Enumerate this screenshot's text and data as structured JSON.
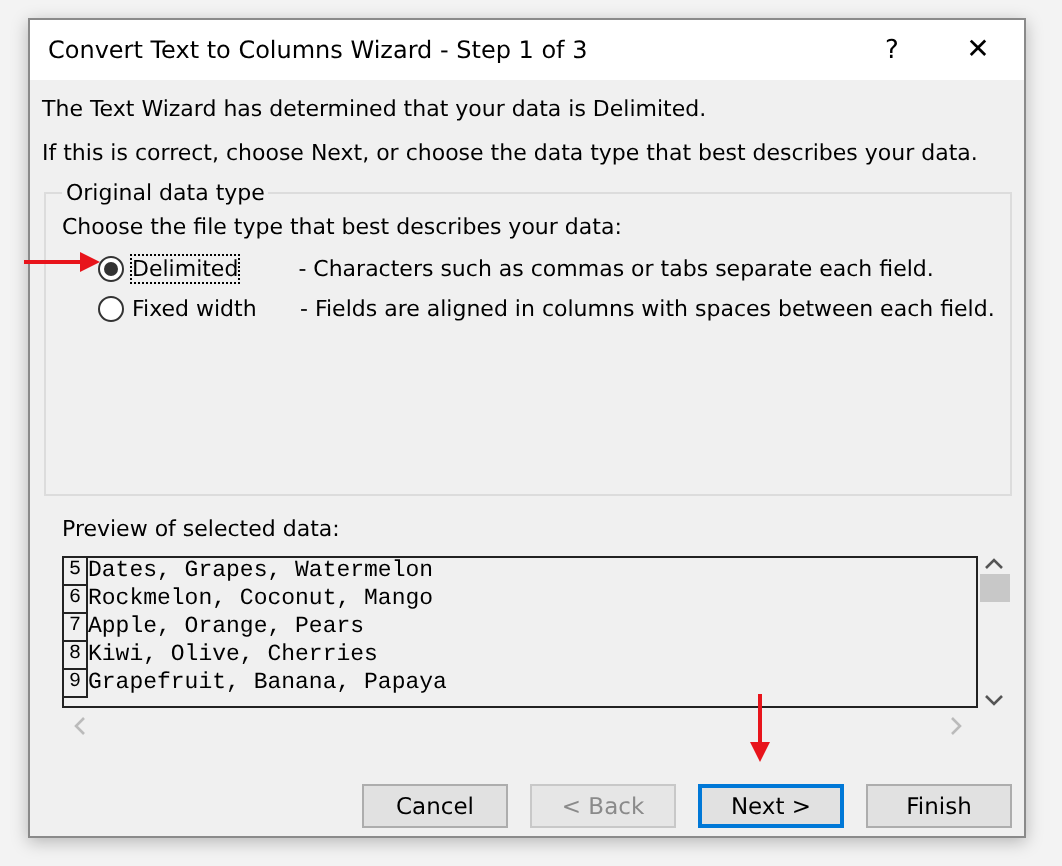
{
  "window": {
    "title": "Convert Text to Columns Wizard - Step 1 of 3",
    "help": "?",
    "close": "✕"
  },
  "intro": [
    "The Text Wizard has determined that your data is Delimited.",
    "If this is correct, choose Next, or choose the data type that best describes your data."
  ],
  "group": {
    "title": "Original data type",
    "prompt": "Choose the file type that best describes your data:",
    "options": [
      {
        "label": "Delimited",
        "description": "- Characters such as commas or tabs separate each field.",
        "selected": true
      },
      {
        "label": "Fixed width",
        "description": "- Fields are aligned in columns with spaces between each field.",
        "selected": false
      }
    ]
  },
  "preview": {
    "label": "Preview of selected data:",
    "rows": [
      {
        "number": "5",
        "text": "Dates, Grapes, Watermelon"
      },
      {
        "number": "6",
        "text": "Rockmelon, Coconut, Mango"
      },
      {
        "number": "7",
        "text": "Apple, Orange, Pears"
      },
      {
        "number": "8",
        "text": "Kiwi, Olive, Cherries"
      },
      {
        "number": "9",
        "text": "Grapefruit, Banana, Papaya"
      }
    ]
  },
  "buttons": [
    {
      "label": "Cancel",
      "disabled": false,
      "default": false
    },
    {
      "label": "< Back",
      "disabled": true,
      "default": false
    },
    {
      "label": "Next >",
      "disabled": false,
      "default": true
    },
    {
      "label": "Finish",
      "disabled": false,
      "default": false
    }
  ]
}
